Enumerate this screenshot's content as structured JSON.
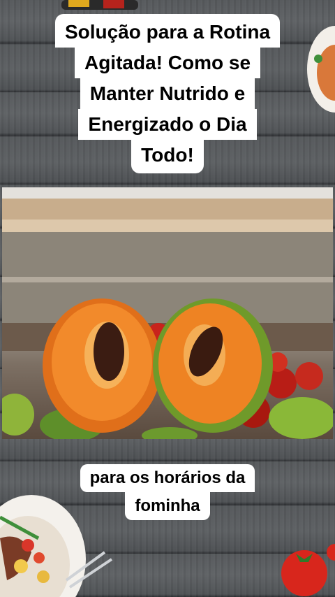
{
  "title_lines": [
    "Solução para a Rotina",
    "Agitada! Como se",
    "Manter Nutrido e",
    "Energizado o Dia",
    "Todo!"
  ],
  "subtitle_lines": [
    "para os horários da",
    "fominha"
  ]
}
